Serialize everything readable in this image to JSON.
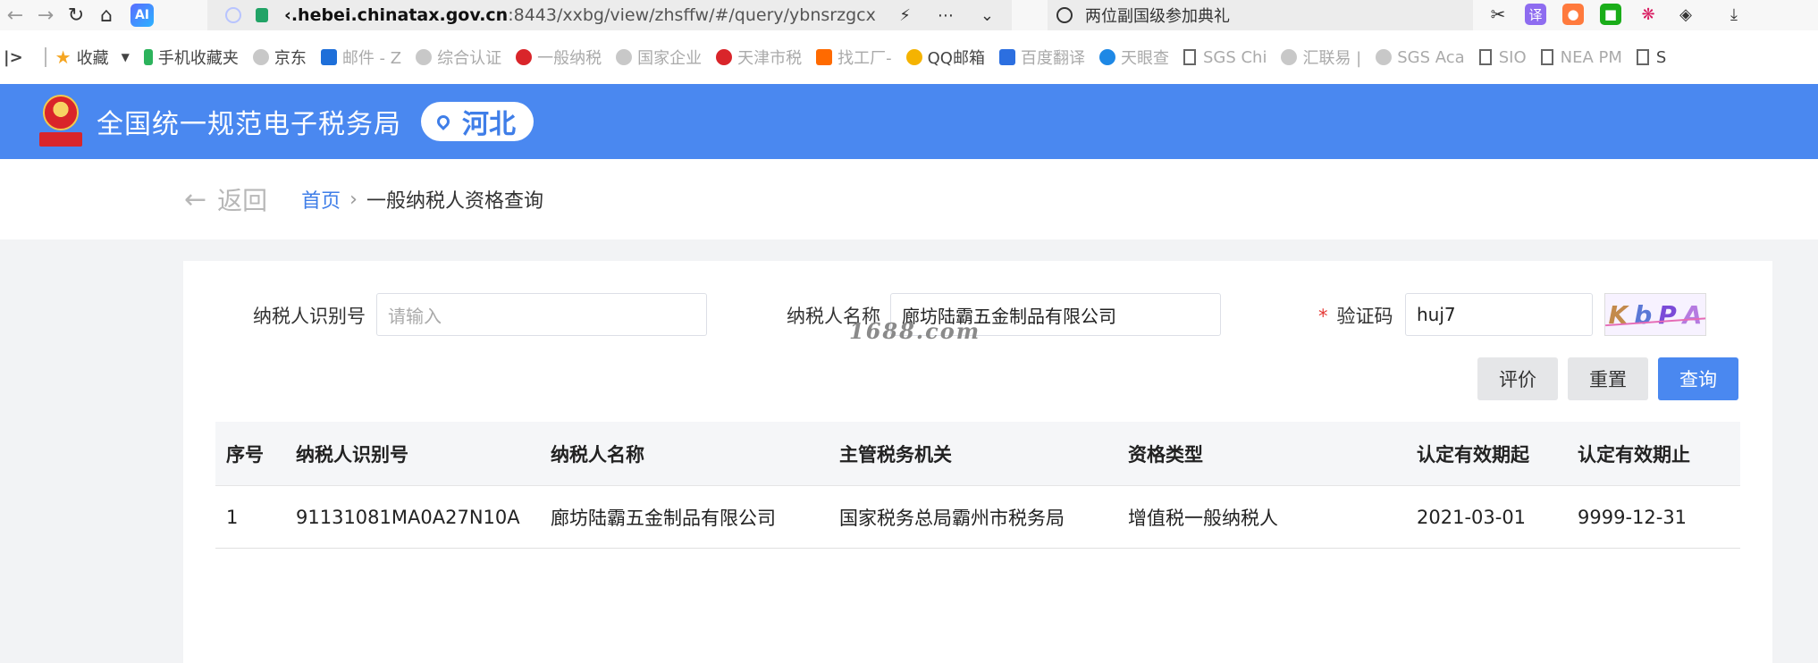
{
  "browser": {
    "url_host": "‹.hebei.chinatax.gov.cn",
    "url_path": ":8443/xxbg/view/zhsffw/#/query/ybnsrzgcx",
    "search_text": "两位副国级参加典礼",
    "ai_label": "AI",
    "ext_translate": "译"
  },
  "bookmarks": {
    "favorites": "收藏",
    "mobile": "手机收藏夹",
    "jd": "京东",
    "mail": "邮件 - Z",
    "cert": "综合认证",
    "taxpayer": "一般纳税",
    "enterprise": "国家企业",
    "tianjin": "天津市税",
    "factory": "找工厂-",
    "qqmail": "QQ邮箱",
    "baidu": "百度翻译",
    "tianyan": "天眼查",
    "sgs_ch": "SGS Chi",
    "huilian": "汇联易 |",
    "sgs_aca": "SGS Aca",
    "sio": "SIO",
    "nea": "NEA PM",
    "s_last": "S"
  },
  "header": {
    "site_title": "全国统一规范电子税务局",
    "region": "河北"
  },
  "breadcrumb": {
    "back": "返回",
    "home": "首页",
    "current": "一般纳税人资格查询"
  },
  "form": {
    "taxpayer_id_label": "纳税人识别号",
    "taxpayer_id_placeholder": "请输入",
    "taxpayer_name_label": "纳税人名称",
    "taxpayer_name_value": "廊坊陆霸五金制品有限公司",
    "captcha_label": "验证码",
    "captcha_value": "huj7",
    "captcha_image_text": [
      "K",
      "b",
      "P",
      "A"
    ],
    "watermark": "1688.com"
  },
  "buttons": {
    "evaluate": "评价",
    "reset": "重置",
    "query": "查询"
  },
  "table": {
    "headers": [
      "序号",
      "纳税人识别号",
      "纳税人名称",
      "主管税务机关",
      "资格类型",
      "认定有效期起",
      "认定有效期止"
    ],
    "rows": [
      [
        "1",
        "91131081MA0A27N10A",
        "廊坊陆霸五金制品有限公司",
        "国家税务总局霸州市税务局",
        "增值税一般纳税人",
        "2021-03-01",
        "9999-12-31"
      ]
    ]
  },
  "colors": {
    "brand_blue": "#4a88f0",
    "required_red": "#e53935"
  }
}
